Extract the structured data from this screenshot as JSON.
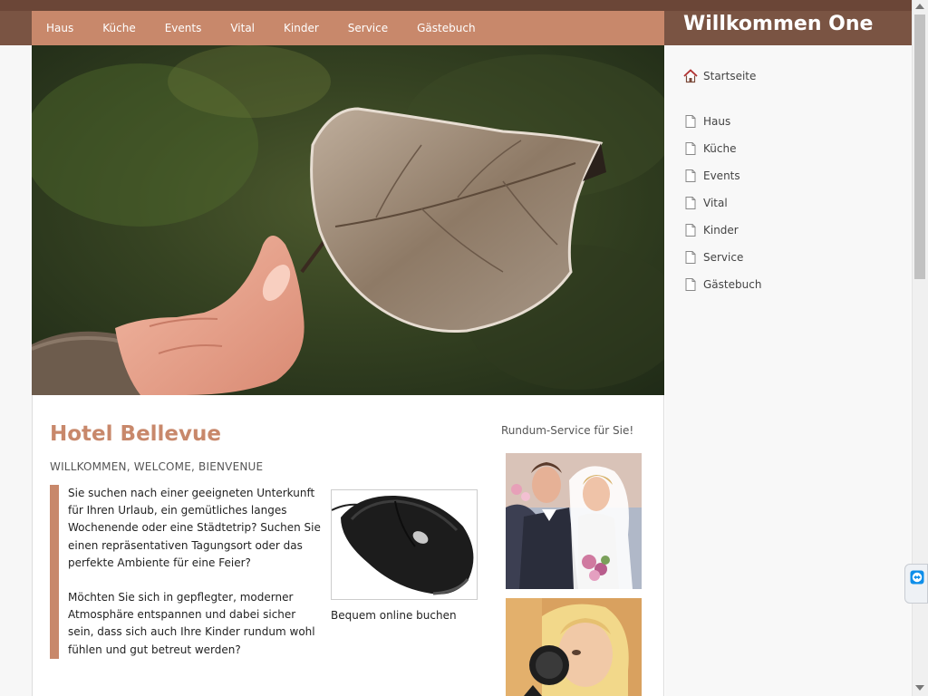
{
  "site": {
    "title": "Willkommen One"
  },
  "nav": {
    "items": [
      "Haus",
      "Küche",
      "Events",
      "Vital",
      "Kinder",
      "Service",
      "Gästebuch"
    ]
  },
  "sidebar": {
    "home_label": "Startseite",
    "items": [
      "Haus",
      "Küche",
      "Events",
      "Vital",
      "Kinder",
      "Service",
      "Gästebuch"
    ]
  },
  "main": {
    "heading": "Hotel Bellevue",
    "subheading": "WILLKOMMEN, WELCOME, BIENVENUE",
    "paragraphs": [
      "Sie suchen nach einer geeigneten Unterkunft für Ihren Urlaub, ein gemütliches langes Wochenende oder eine Städtetrip? Suchen Sie einen repräsentativen Tagungsort oder das perfekte Ambiente für eine Feier?",
      "Möchten Sie sich in gepflegter, moderner Atmosphäre entspannen und dabei sicher sein, dass sich auch Ihre Kinder rundum wohl fühlen und gut betreut werden?"
    ],
    "image_caption": "Bequem online buchen"
  },
  "aside": {
    "title": "Rundum-Service für Sie!"
  },
  "colors": {
    "brand": "#c8886b",
    "header_dark": "#7a5443"
  },
  "icons": {
    "home": "home-icon",
    "page": "page-icon"
  }
}
